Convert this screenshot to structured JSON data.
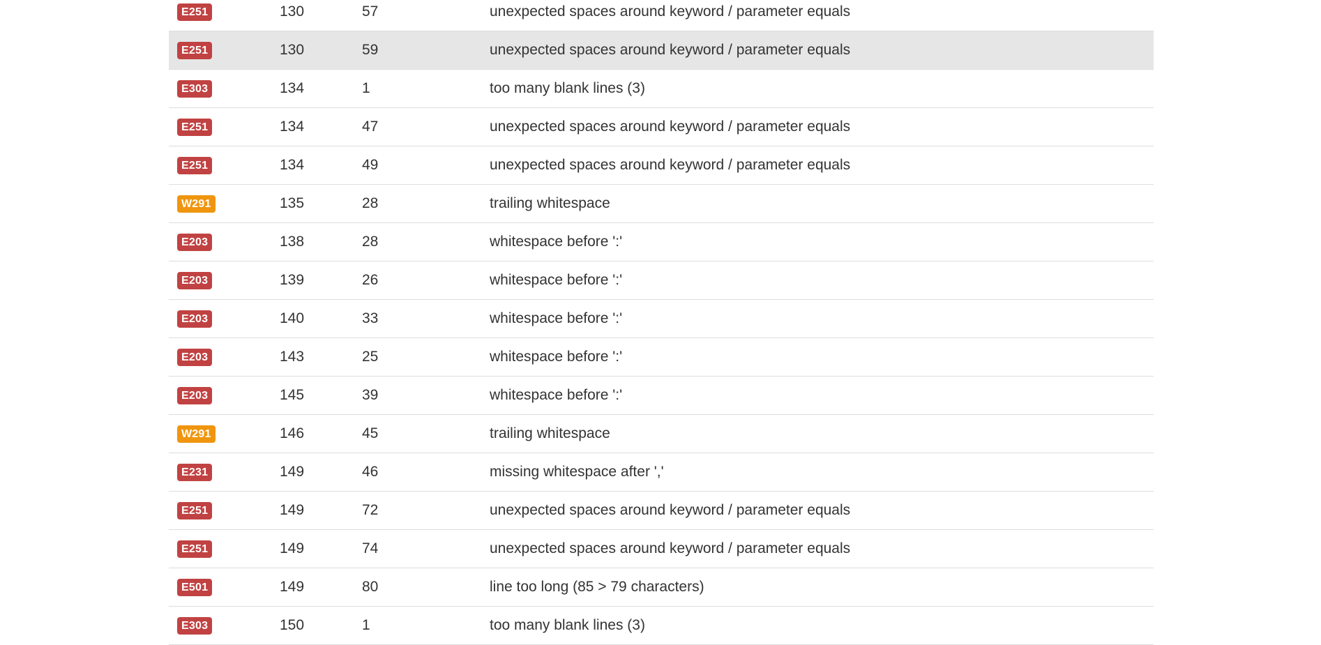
{
  "colors": {
    "error_badge": "#c14242",
    "warning_badge": "#f0950e",
    "highlight_row": "#e6e6e6"
  },
  "rows": [
    {
      "code": "E251",
      "severity": "error",
      "line": "130",
      "col": "57",
      "message": "unexpected spaces around keyword / parameter equals"
    },
    {
      "code": "E251",
      "severity": "error",
      "line": "130",
      "col": "59",
      "message": "unexpected spaces around keyword / parameter equals",
      "highlighted": true
    },
    {
      "code": "E303",
      "severity": "error",
      "line": "134",
      "col": "1",
      "message": "too many blank lines (3)"
    },
    {
      "code": "E251",
      "severity": "error",
      "line": "134",
      "col": "47",
      "message": "unexpected spaces around keyword / parameter equals"
    },
    {
      "code": "E251",
      "severity": "error",
      "line": "134",
      "col": "49",
      "message": "unexpected spaces around keyword / parameter equals"
    },
    {
      "code": "W291",
      "severity": "warning",
      "line": "135",
      "col": "28",
      "message": "trailing whitespace"
    },
    {
      "code": "E203",
      "severity": "error",
      "line": "138",
      "col": "28",
      "message": "whitespace before ':'"
    },
    {
      "code": "E203",
      "severity": "error",
      "line": "139",
      "col": "26",
      "message": "whitespace before ':'"
    },
    {
      "code": "E203",
      "severity": "error",
      "line": "140",
      "col": "33",
      "message": "whitespace before ':'"
    },
    {
      "code": "E203",
      "severity": "error",
      "line": "143",
      "col": "25",
      "message": "whitespace before ':'"
    },
    {
      "code": "E203",
      "severity": "error",
      "line": "145",
      "col": "39",
      "message": "whitespace before ':'"
    },
    {
      "code": "W291",
      "severity": "warning",
      "line": "146",
      "col": "45",
      "message": "trailing whitespace"
    },
    {
      "code": "E231",
      "severity": "error",
      "line": "149",
      "col": "46",
      "message": "missing whitespace after ','"
    },
    {
      "code": "E251",
      "severity": "error",
      "line": "149",
      "col": "72",
      "message": "unexpected spaces around keyword / parameter equals"
    },
    {
      "code": "E251",
      "severity": "error",
      "line": "149",
      "col": "74",
      "message": "unexpected spaces around keyword / parameter equals"
    },
    {
      "code": "E501",
      "severity": "error",
      "line": "149",
      "col": "80",
      "message": "line too long (85 > 79 characters)"
    },
    {
      "code": "E303",
      "severity": "error",
      "line": "150",
      "col": "1",
      "message": "too many blank lines (3)"
    }
  ]
}
